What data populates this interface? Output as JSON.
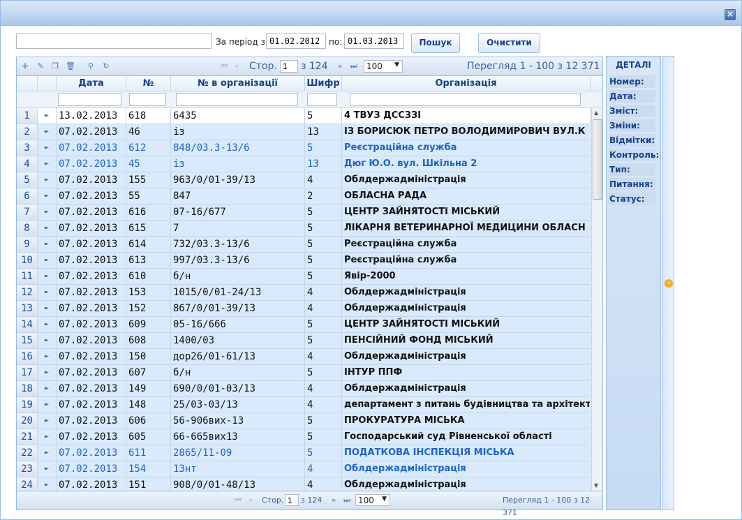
{
  "filter": {
    "search_value": "",
    "period_from_label": "За період з:",
    "date_from": "01.02.2012",
    "period_to_label": "по:",
    "date_to": "01.03.2013",
    "search_button": "Пошук",
    "clear_button": "Очистити"
  },
  "toolbar": {
    "page_label": "Стор.",
    "page_value": "1",
    "page_of": "з 124",
    "page_size": "100",
    "view_info": "Перегляд 1 - 100 з 12 371",
    "icons": [
      "add-icon",
      "edit-icon",
      "copy-icon",
      "delete-icon",
      "search-icon",
      "refresh-icon"
    ]
  },
  "columns": [
    "Дата",
    "№",
    "№ в організації",
    "Шифр",
    "Організація"
  ],
  "rows": [
    {
      "n": "1",
      "date": "13.02.2013",
      "no": "618",
      "org_no": "6435",
      "code": "5",
      "org": "4 ТВУЗ ДССЗЗІ",
      "style": "first"
    },
    {
      "n": "2",
      "date": "07.02.2013",
      "no": "46",
      "org_no": "із",
      "code": "13",
      "org": "ІЗ БОРИСЮК ПЕТРО ВОЛОДИМИРОВИЧ ВУЛ.К",
      "style": "normal"
    },
    {
      "n": "3",
      "date": "07.02.2013",
      "no": "612",
      "org_no": "848/03.3-13/6",
      "code": "5",
      "org": "Реєстраційна служба",
      "style": "blue"
    },
    {
      "n": "4",
      "date": "07.02.2013",
      "no": "45",
      "org_no": "із",
      "code": "13",
      "org": "Дюг Ю.О. вул. Шкільна 2",
      "style": "blue"
    },
    {
      "n": "5",
      "date": "07.02.2013",
      "no": "155",
      "org_no": "963/0/01-39/13",
      "code": "4",
      "org": "Облдержадміністрація",
      "style": "normal"
    },
    {
      "n": "6",
      "date": "07.02.2013",
      "no": "55",
      "org_no": "847",
      "code": "2",
      "org": "ОБЛАСНА РАДА",
      "style": "normal"
    },
    {
      "n": "7",
      "date": "07.02.2013",
      "no": "616",
      "org_no": "07-16/677",
      "code": "5",
      "org": "ЦЕНТР ЗАЙНЯТОСТІ МІСЬКИЙ",
      "style": "normal"
    },
    {
      "n": "8",
      "date": "07.02.2013",
      "no": "615",
      "org_no": "7",
      "code": "5",
      "org": "ЛІКАРНЯ ВЕТЕРИНАРНОЇ МЕДИЦИНИ ОБЛАСН",
      "style": "normal"
    },
    {
      "n": "9",
      "date": "07.02.2013",
      "no": "614",
      "org_no": "732/03.3-13/6",
      "code": "5",
      "org": "Реєстраційна служба",
      "style": "normal"
    },
    {
      "n": "10",
      "date": "07.02.2013",
      "no": "613",
      "org_no": "997/03.3-13/6",
      "code": "5",
      "org": "Реєстраційна служба",
      "style": "normal"
    },
    {
      "n": "11",
      "date": "07.02.2013",
      "no": "610",
      "org_no": "б/н",
      "code": "5",
      "org": "Явір-2000",
      "style": "normal"
    },
    {
      "n": "12",
      "date": "07.02.2013",
      "no": "153",
      "org_no": "1015/0/01-24/13",
      "code": "4",
      "org": "Облдержадміністрація",
      "style": "normal"
    },
    {
      "n": "13",
      "date": "07.02.2013",
      "no": "152",
      "org_no": "867/0/01-39/13",
      "code": "4",
      "org": "Облдержадміністрація",
      "style": "normal"
    },
    {
      "n": "14",
      "date": "07.02.2013",
      "no": "609",
      "org_no": "05-16/666",
      "code": "5",
      "org": "ЦЕНТР ЗАЙНЯТОСТІ МІСЬКИЙ",
      "style": "normal"
    },
    {
      "n": "15",
      "date": "07.02.2013",
      "no": "608",
      "org_no": "1400/03",
      "code": "5",
      "org": "ПЕНСІЙНИЙ ФОНД МІСЬКИЙ",
      "style": "normal"
    },
    {
      "n": "16",
      "date": "07.02.2013",
      "no": "150",
      "org_no": "дор26/01-61/13",
      "code": "4",
      "org": "Облдержадміністрація",
      "style": "normal"
    },
    {
      "n": "17",
      "date": "07.02.2013",
      "no": "607",
      "org_no": "б/н",
      "code": "5",
      "org": "ІНТУР ППФ",
      "style": "normal"
    },
    {
      "n": "18",
      "date": "07.02.2013",
      "no": "149",
      "org_no": "690/0/01-03/13",
      "code": "4",
      "org": "Облдержадміністрація",
      "style": "normal"
    },
    {
      "n": "19",
      "date": "07.02.2013",
      "no": "148",
      "org_no": "25/03-03/13",
      "code": "4",
      "org": "департамент з питань будівництва та архітектур",
      "style": "normal"
    },
    {
      "n": "20",
      "date": "07.02.2013",
      "no": "606",
      "org_no": "56-906вих-13",
      "code": "5",
      "org": "ПРОКУРАТУРА МІСЬКА",
      "style": "normal"
    },
    {
      "n": "21",
      "date": "07.02.2013",
      "no": "605",
      "org_no": "66-665вих13",
      "code": "5",
      "org": "Господарський суд Рівненської області",
      "style": "normal"
    },
    {
      "n": "22",
      "date": "07.02.2013",
      "no": "611",
      "org_no": "2865/11-09",
      "code": "5",
      "org": "ПОДАТКОВА ІНСПЕКЦІЯ МІСЬКА",
      "style": "blue"
    },
    {
      "n": "23",
      "date": "07.02.2013",
      "no": "154",
      "org_no": "13нт",
      "code": "4",
      "org": "Облдержадміністрація",
      "style": "blue"
    },
    {
      "n": "24",
      "date": "07.02.2013",
      "no": "151",
      "org_no": "908/0/01-48/13",
      "code": "4",
      "org": "Облдержадміністрація",
      "style": "normal"
    }
  ],
  "bottombar": {
    "page_label": "Стор.",
    "page_value": "1",
    "page_of": "з 124",
    "page_size": "100",
    "view_info": "Перегляд 1 - 100 з 12 371"
  },
  "details": {
    "title": "ДЕТАЛІ",
    "fields": [
      "Номер:",
      "Дата:",
      "Зміст:",
      "Зміни:",
      "Відмітки:",
      "Контроль:",
      "Тип:",
      "Питання:",
      "Статус:"
    ]
  },
  "colors": {
    "accent": "#15428b",
    "row_bg": "#d8eafb",
    "blue_text": "#1d63c8",
    "border": "#99bbe8"
  }
}
